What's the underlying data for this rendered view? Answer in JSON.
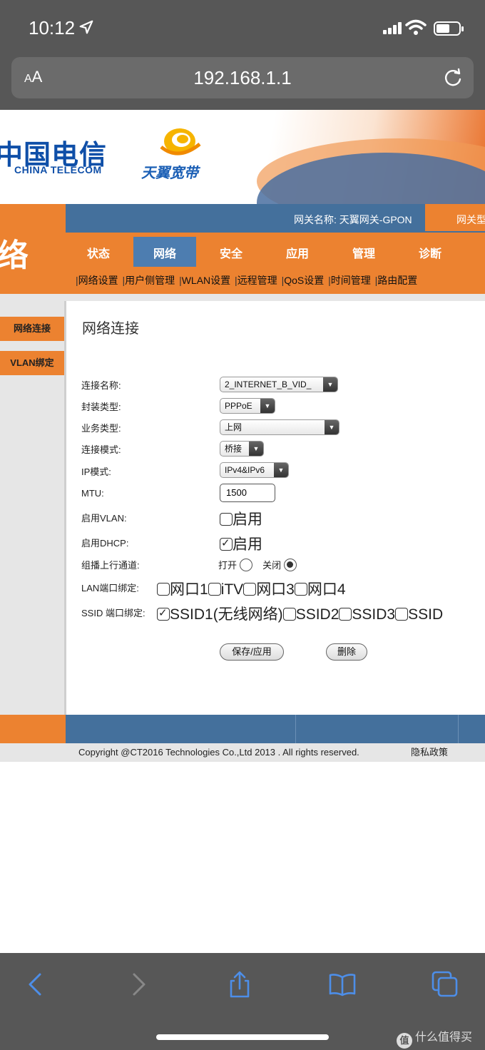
{
  "status_bar": {
    "time": "10:12"
  },
  "browser": {
    "aa_label_small": "A",
    "aa_label_big": "A",
    "url": "192.168.1.1"
  },
  "header": {
    "carrier_logo": "中国电信",
    "carrier_logo_en": "CHINA TELECOM",
    "brand_text": "天翼宽带",
    "left_big_text": "络",
    "gateway_name": "网关名称:   天翼网关-GPON",
    "gateway_type_tab": "网关型"
  },
  "nav": {
    "tabs": [
      {
        "label": "状态"
      },
      {
        "label": "网络"
      },
      {
        "label": "安全"
      },
      {
        "label": "应用"
      },
      {
        "label": "管理"
      },
      {
        "label": "诊断"
      }
    ],
    "sub_items": [
      {
        "label": "网络设置"
      },
      {
        "label": "用户侧管理"
      },
      {
        "label": "WLAN设置"
      },
      {
        "label": "远程管理"
      },
      {
        "label": "QoS设置"
      },
      {
        "label": "时间管理"
      },
      {
        "label": "路由配置"
      }
    ]
  },
  "sidebar": {
    "items": [
      {
        "label": "网络连接"
      },
      {
        "label": "VLAN绑定"
      }
    ]
  },
  "form": {
    "title": "网络连接",
    "connection_name": {
      "label": "连接名称:",
      "value": "2_INTERNET_B_VID_"
    },
    "encap_type": {
      "label": "封装类型:",
      "value": "PPPoE"
    },
    "service_type": {
      "label": "业务类型:",
      "value": "上网"
    },
    "connection_mode": {
      "label": "连接模式:",
      "value": "桥接"
    },
    "ip_mode": {
      "label": "IP模式:",
      "value": "IPv4&IPv6"
    },
    "mtu": {
      "label": "MTU:",
      "value": "1500"
    },
    "vlan": {
      "label": "启用VLAN:",
      "option": "启用",
      "checked": false
    },
    "dhcp": {
      "label": "启用DHCP:",
      "option": "启用",
      "checked": true
    },
    "multicast": {
      "label": "组播上行通道:",
      "open": "打开",
      "close": "关闭",
      "selected": "close"
    },
    "lan_binding": {
      "label": "LAN端口绑定:",
      "ports": [
        "网口1",
        "iTV",
        "网口3",
        "网口4"
      ]
    },
    "ssid_binding": {
      "label": "SSID 端口绑定:",
      "ssids": [
        "SSID1(无线网络)",
        "SSID2",
        "SSID3",
        "SSID"
      ]
    },
    "save_button": "保存/应用",
    "delete_button": "删除"
  },
  "footer": {
    "copyright": "Copyright @CT2016 Technologies Co.,Ltd 2013 . All rights reserved.",
    "privacy": "隐私政策"
  },
  "watermark": {
    "icon": "值",
    "text": "什么值得买"
  },
  "colors": {
    "orange": "#ec8230",
    "blue": "#44709c",
    "ios_gray": "#575757"
  }
}
